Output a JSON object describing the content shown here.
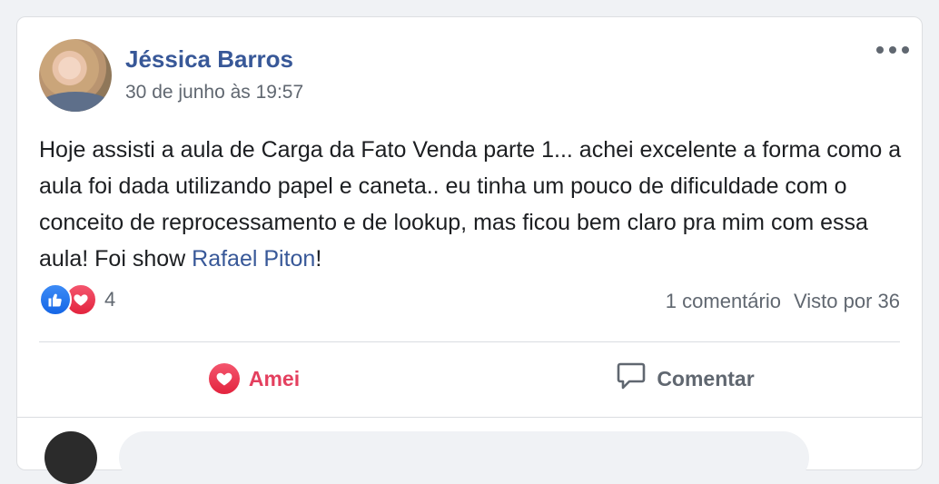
{
  "post": {
    "author": "Jéssica Barros",
    "timestamp": "30 de junho às 19:57",
    "text_before_mention": "Hoje assisti a aula de Carga da Fato Venda parte 1... achei excelente a forma como a aula foi dada utilizando papel e caneta.. eu tinha um pouco de dificuldade com o conceito de reprocessamento e de lookup, mas ficou bem claro pra mim com essa aula! Foi show ",
    "mention": "Rafael Piton",
    "text_after_mention": "!"
  },
  "reactions": {
    "icons": [
      "like-icon",
      "love-icon"
    ],
    "count": "4"
  },
  "stats": {
    "comments": "1 comentário",
    "seen_by": "Visto por 36"
  },
  "actions": {
    "love_label": "Amei",
    "comment_label": "Comentar"
  },
  "colors": {
    "link": "#385898",
    "love": "#e4405f",
    "like": "#1877f2",
    "muted": "#606770"
  }
}
